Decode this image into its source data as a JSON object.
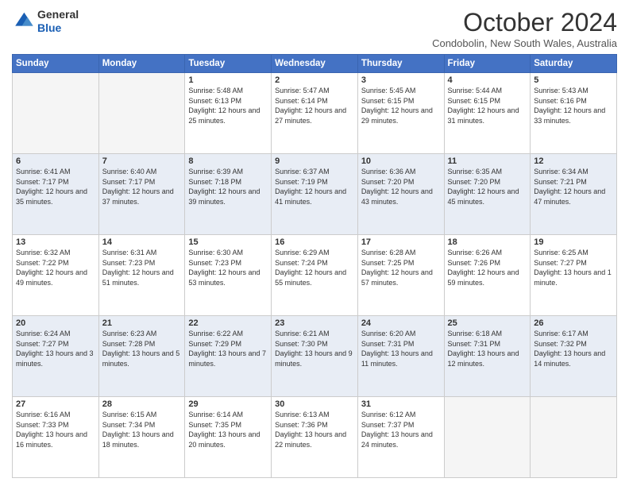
{
  "logo": {
    "line1": "General",
    "line2": "Blue"
  },
  "header": {
    "title": "October 2024",
    "location": "Condobolin, New South Wales, Australia"
  },
  "days_of_week": [
    "Sunday",
    "Monday",
    "Tuesday",
    "Wednesday",
    "Thursday",
    "Friday",
    "Saturday"
  ],
  "weeks": [
    [
      {
        "day": "",
        "info": ""
      },
      {
        "day": "",
        "info": ""
      },
      {
        "day": "1",
        "info": "Sunrise: 5:48 AM\nSunset: 6:13 PM\nDaylight: 12 hours and 25 minutes."
      },
      {
        "day": "2",
        "info": "Sunrise: 5:47 AM\nSunset: 6:14 PM\nDaylight: 12 hours and 27 minutes."
      },
      {
        "day": "3",
        "info": "Sunrise: 5:45 AM\nSunset: 6:15 PM\nDaylight: 12 hours and 29 minutes."
      },
      {
        "day": "4",
        "info": "Sunrise: 5:44 AM\nSunset: 6:15 PM\nDaylight: 12 hours and 31 minutes."
      },
      {
        "day": "5",
        "info": "Sunrise: 5:43 AM\nSunset: 6:16 PM\nDaylight: 12 hours and 33 minutes."
      }
    ],
    [
      {
        "day": "6",
        "info": "Sunrise: 6:41 AM\nSunset: 7:17 PM\nDaylight: 12 hours and 35 minutes."
      },
      {
        "day": "7",
        "info": "Sunrise: 6:40 AM\nSunset: 7:17 PM\nDaylight: 12 hours and 37 minutes."
      },
      {
        "day": "8",
        "info": "Sunrise: 6:39 AM\nSunset: 7:18 PM\nDaylight: 12 hours and 39 minutes."
      },
      {
        "day": "9",
        "info": "Sunrise: 6:37 AM\nSunset: 7:19 PM\nDaylight: 12 hours and 41 minutes."
      },
      {
        "day": "10",
        "info": "Sunrise: 6:36 AM\nSunset: 7:20 PM\nDaylight: 12 hours and 43 minutes."
      },
      {
        "day": "11",
        "info": "Sunrise: 6:35 AM\nSunset: 7:20 PM\nDaylight: 12 hours and 45 minutes."
      },
      {
        "day": "12",
        "info": "Sunrise: 6:34 AM\nSunset: 7:21 PM\nDaylight: 12 hours and 47 minutes."
      }
    ],
    [
      {
        "day": "13",
        "info": "Sunrise: 6:32 AM\nSunset: 7:22 PM\nDaylight: 12 hours and 49 minutes."
      },
      {
        "day": "14",
        "info": "Sunrise: 6:31 AM\nSunset: 7:23 PM\nDaylight: 12 hours and 51 minutes."
      },
      {
        "day": "15",
        "info": "Sunrise: 6:30 AM\nSunset: 7:23 PM\nDaylight: 12 hours and 53 minutes."
      },
      {
        "day": "16",
        "info": "Sunrise: 6:29 AM\nSunset: 7:24 PM\nDaylight: 12 hours and 55 minutes."
      },
      {
        "day": "17",
        "info": "Sunrise: 6:28 AM\nSunset: 7:25 PM\nDaylight: 12 hours and 57 minutes."
      },
      {
        "day": "18",
        "info": "Sunrise: 6:26 AM\nSunset: 7:26 PM\nDaylight: 12 hours and 59 minutes."
      },
      {
        "day": "19",
        "info": "Sunrise: 6:25 AM\nSunset: 7:27 PM\nDaylight: 13 hours and 1 minute."
      }
    ],
    [
      {
        "day": "20",
        "info": "Sunrise: 6:24 AM\nSunset: 7:27 PM\nDaylight: 13 hours and 3 minutes."
      },
      {
        "day": "21",
        "info": "Sunrise: 6:23 AM\nSunset: 7:28 PM\nDaylight: 13 hours and 5 minutes."
      },
      {
        "day": "22",
        "info": "Sunrise: 6:22 AM\nSunset: 7:29 PM\nDaylight: 13 hours and 7 minutes."
      },
      {
        "day": "23",
        "info": "Sunrise: 6:21 AM\nSunset: 7:30 PM\nDaylight: 13 hours and 9 minutes."
      },
      {
        "day": "24",
        "info": "Sunrise: 6:20 AM\nSunset: 7:31 PM\nDaylight: 13 hours and 11 minutes."
      },
      {
        "day": "25",
        "info": "Sunrise: 6:18 AM\nSunset: 7:31 PM\nDaylight: 13 hours and 12 minutes."
      },
      {
        "day": "26",
        "info": "Sunrise: 6:17 AM\nSunset: 7:32 PM\nDaylight: 13 hours and 14 minutes."
      }
    ],
    [
      {
        "day": "27",
        "info": "Sunrise: 6:16 AM\nSunset: 7:33 PM\nDaylight: 13 hours and 16 minutes."
      },
      {
        "day": "28",
        "info": "Sunrise: 6:15 AM\nSunset: 7:34 PM\nDaylight: 13 hours and 18 minutes."
      },
      {
        "day": "29",
        "info": "Sunrise: 6:14 AM\nSunset: 7:35 PM\nDaylight: 13 hours and 20 minutes."
      },
      {
        "day": "30",
        "info": "Sunrise: 6:13 AM\nSunset: 7:36 PM\nDaylight: 13 hours and 22 minutes."
      },
      {
        "day": "31",
        "info": "Sunrise: 6:12 AM\nSunset: 7:37 PM\nDaylight: 13 hours and 24 minutes."
      },
      {
        "day": "",
        "info": ""
      },
      {
        "day": "",
        "info": ""
      }
    ]
  ]
}
